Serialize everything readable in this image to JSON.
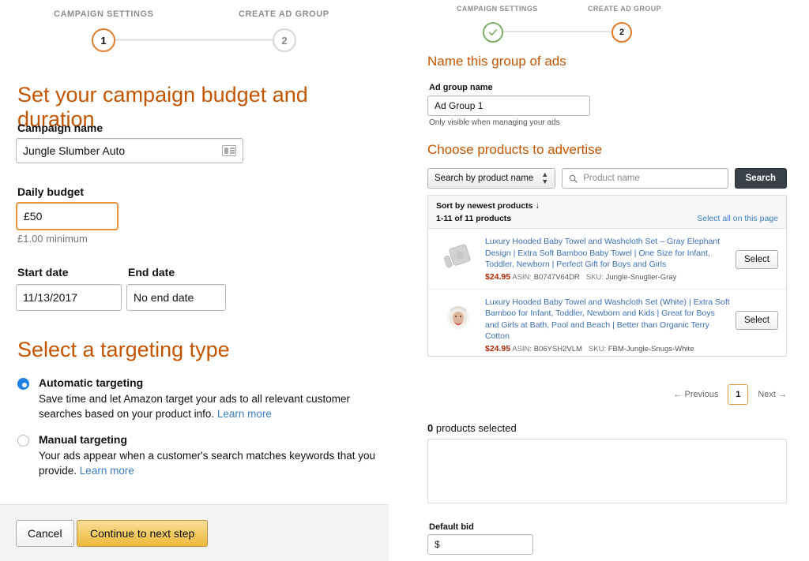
{
  "left": {
    "stepper": {
      "step1_label": "CAMPAIGN SETTINGS",
      "step2_label": "CREATE AD GROUP",
      "step1_number": "1",
      "step2_number": "2"
    },
    "heading": "Set your campaign budget and duration",
    "campaign_name": {
      "label": "Campaign name",
      "value": "Jungle Slumber Auto"
    },
    "daily_budget": {
      "label": "Daily budget",
      "value": "£50",
      "hint": "£1.00 minimum"
    },
    "start_date": {
      "label": "Start date",
      "value": "11/13/2017"
    },
    "end_date": {
      "label": "End date",
      "value": "No end date"
    },
    "targeting": {
      "heading": "Select a targeting type",
      "options": [
        {
          "title": "Automatic targeting",
          "desc": "Save time and let Amazon target your ads to all relevant customer searches based on your product info.",
          "link": "Learn more",
          "selected": true
        },
        {
          "title": "Manual targeting",
          "desc": "Your ads appear when a customer's search matches keywords that you provide.",
          "link": "Learn more",
          "selected": false
        }
      ]
    },
    "footer": {
      "cancel_label": "Cancel",
      "continue_label": "Continue to next step"
    }
  },
  "right": {
    "stepper": {
      "step1_label": "CAMPAIGN SETTINGS",
      "step2_label": "CREATE AD GROUP",
      "step2_number": "2"
    },
    "name_group": {
      "heading": "Name this group of ads",
      "label": "Ad group name",
      "value": "Ad Group 1",
      "hint": "Only visible when managing your ads"
    },
    "choose_products": {
      "heading": "Choose products to advertise",
      "search_type": "Search by product name",
      "search_placeholder": "Product name",
      "search_button": "Search",
      "sort_label": "Sort by newest products",
      "count_label": "1-11 of 11 products",
      "select_all_label": "Select all on this page",
      "products": [
        {
          "title": "Luxury Hooded Baby Towel and Washcloth Set – Gray Elephant Design | Extra Soft Bamboo Baby Towel | One Size for Infant, Toddler, Newborn | Perfect Gift for Boys and Girls",
          "price": "$24.95",
          "asin_key": "ASIN:",
          "asin": "B0747V64DR",
          "sku_key": "SKU:",
          "sku": "Jungle-Snuglier-Gray",
          "select_label": "Select"
        },
        {
          "title": "Luxury Hooded Baby Towel and Washcloth Set (White) | Extra Soft Bamboo for Infant, Toddler, Newborn and Kids | Great for Boys and Girls at Bath, Pool and Beach | Better than Organic Terry Cotton",
          "price": "$24.95",
          "asin_key": "ASIN:",
          "asin": "B06YSH2VLM",
          "sku_key": "SKU:",
          "sku": "FBM-Jungle-Snugs-White",
          "select_label": "Select"
        }
      ],
      "pagination": {
        "previous": "Previous",
        "current": "1",
        "next": "Next"
      }
    },
    "selected_summary": {
      "count": "0",
      "text": " products selected"
    },
    "default_bid": {
      "label": "Default bid",
      "value": "$"
    }
  },
  "colors": {
    "accent_orange": "#c45500",
    "step_orange": "#e07b29",
    "link_blue": "#3b7fc4",
    "price_red": "#b12704",
    "check_green": "#7fb069",
    "radio_blue": "#1f7fe0"
  }
}
